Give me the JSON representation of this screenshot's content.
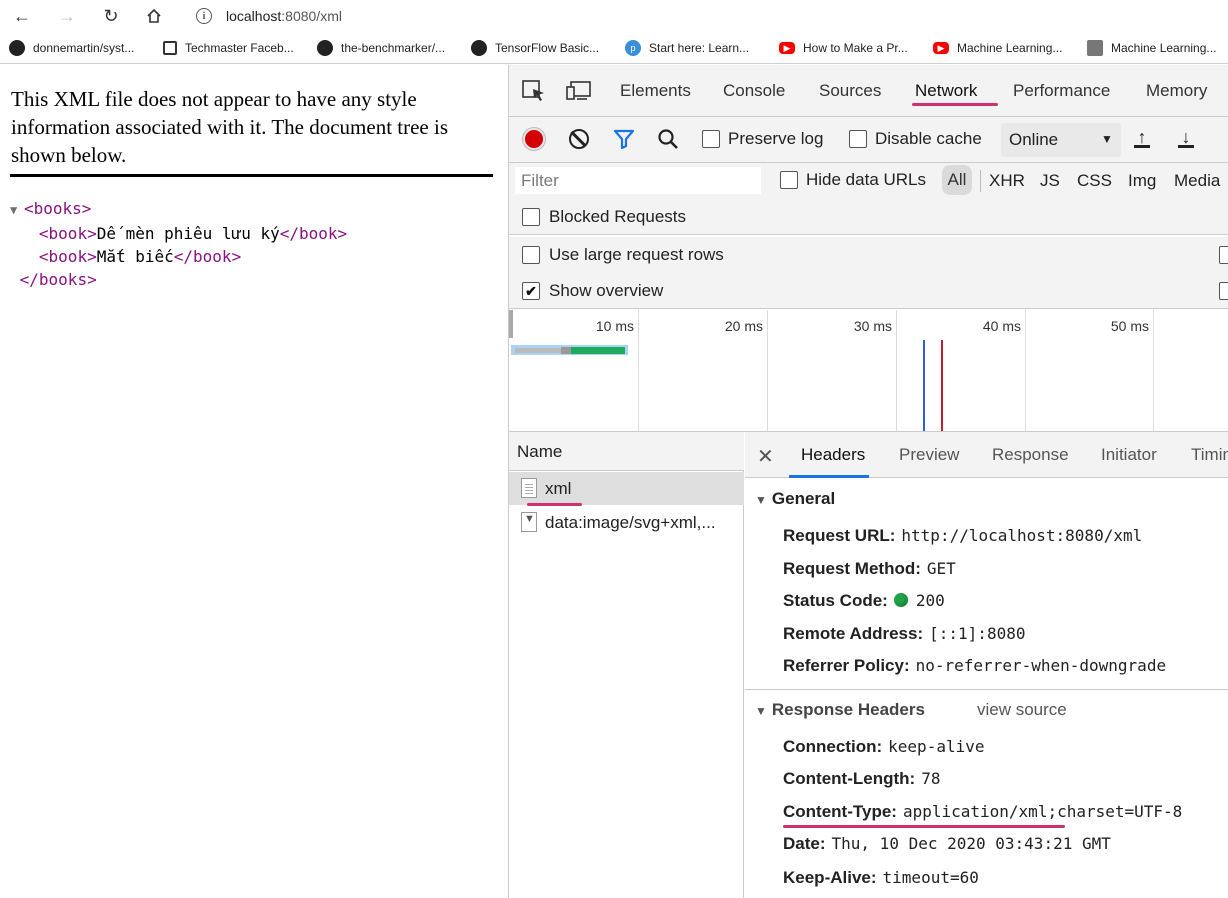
{
  "browser": {
    "url_host": "localhost",
    "url_path": ":8080/xml",
    "bookmarks": [
      {
        "label": "donnemartin/syst...",
        "icon": "github-icon"
      },
      {
        "label": "Techmaster Faceb...",
        "icon": "techmaster-icon"
      },
      {
        "label": "the-benchmarker/...",
        "icon": "github-icon"
      },
      {
        "label": "TensorFlow Basic...",
        "icon": "github-icon"
      },
      {
        "label": "Start here: Learn...",
        "icon": "pv-icon"
      },
      {
        "label": "How to Make a Pr...",
        "icon": "youtube-icon"
      },
      {
        "label": "Machine Learning...",
        "icon": "youtube-icon"
      },
      {
        "label": "Machine Learning...",
        "icon": "photo-icon"
      }
    ]
  },
  "xml_viewer": {
    "notice": "This XML file does not appear to have any style information associated with it. The document tree is shown below.",
    "root_open": "<books>",
    "root_close": "</books>",
    "book_open": "<book>",
    "book_close": "</book>",
    "books": [
      "Dế mèn phiêu lưu ký",
      "Mắt biếc"
    ]
  },
  "devtools": {
    "tabs": [
      "Elements",
      "Console",
      "Sources",
      "Network",
      "Performance",
      "Memory"
    ],
    "active_tab": "Network",
    "controls": {
      "preserve_log": "Preserve log",
      "disable_cache": "Disable cache",
      "throttling": "Online"
    },
    "filter": {
      "placeholder": "Filter",
      "hide_data_urls": "Hide data URLs",
      "types": [
        "All",
        "XHR",
        "JS",
        "CSS",
        "Img",
        "Media"
      ]
    },
    "options": {
      "blocked_requests": "Blocked Requests",
      "large_rows": "Use large request rows",
      "show_overview": "Show overview"
    },
    "overview_ticks": [
      "10 ms",
      "20 ms",
      "30 ms",
      "40 ms",
      "50 ms"
    ],
    "requests": {
      "column": "Name",
      "rows": [
        "xml",
        "data:image/svg+xml,..."
      ]
    },
    "details": {
      "tabs": [
        "Headers",
        "Preview",
        "Response",
        "Initiator",
        "Timin"
      ],
      "general_title": "General",
      "general": [
        {
          "key": "Request URL:",
          "value": "http://localhost:8080/xml"
        },
        {
          "key": "Request Method:",
          "value": "GET"
        },
        {
          "key": "Status Code:",
          "value": "200"
        },
        {
          "key": "Remote Address:",
          "value": "[::1]:8080"
        },
        {
          "key": "Referrer Policy:",
          "value": "no-referrer-when-downgrade"
        }
      ],
      "response_title": "Response Headers",
      "view_source": "view source",
      "response": [
        {
          "key": "Connection:",
          "value": "keep-alive"
        },
        {
          "key": "Content-Length:",
          "value": "78"
        },
        {
          "key": "Content-Type:",
          "value": "application/xml;charset=UTF-8"
        },
        {
          "key": "Date:",
          "value": "Thu, 10 Dec 2020 03:43:21 GMT"
        },
        {
          "key": "Keep-Alive:",
          "value": "timeout=60"
        }
      ]
    },
    "colors": {
      "highlight": "#d0306e",
      "record": "#d40000",
      "status_ok": "#1ea446",
      "tab_accent": "#1a73e8"
    }
  }
}
